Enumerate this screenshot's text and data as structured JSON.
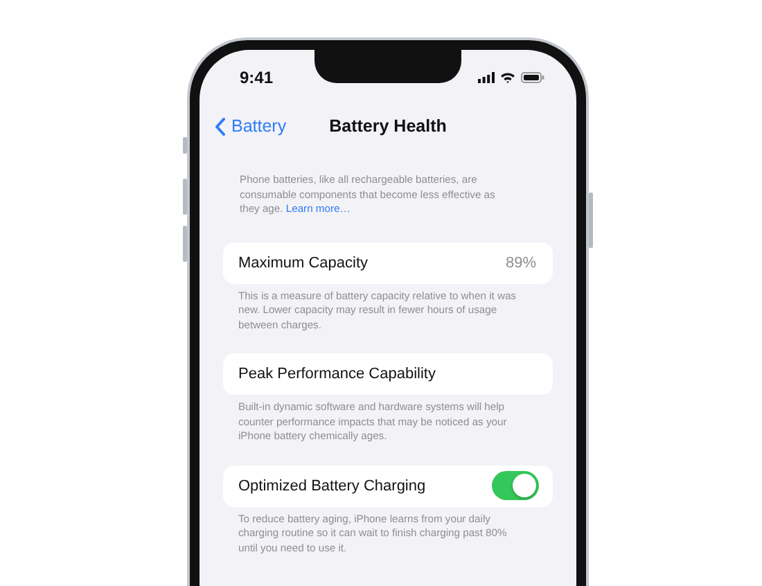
{
  "status_bar": {
    "time": "9:41"
  },
  "nav": {
    "back": "Battery",
    "title": "Battery Health"
  },
  "intro": {
    "text": "Phone batteries, like all rechargeable batteries, are consumable components that become less effective as they age.",
    "link": "Learn more…"
  },
  "sections": [
    {
      "kind": "value",
      "label": "Maximum Capacity",
      "value": "89%",
      "footer": "This is a measure of battery capacity relative to when it was new. Lower capacity may result in fewer hours of usage between charges."
    },
    {
      "kind": "plain",
      "label": "Peak Performance Capability",
      "footer": "Built-in dynamic software and hardware systems will help counter performance impacts that may be noticed as your iPhone battery chemically ages."
    },
    {
      "kind": "toggle",
      "label": "Optimized Battery Charging",
      "on": true,
      "footer": "To reduce battery aging, iPhone learns from your daily charging routine so it can wait to finish charging past 80% until you need to use it."
    }
  ]
}
